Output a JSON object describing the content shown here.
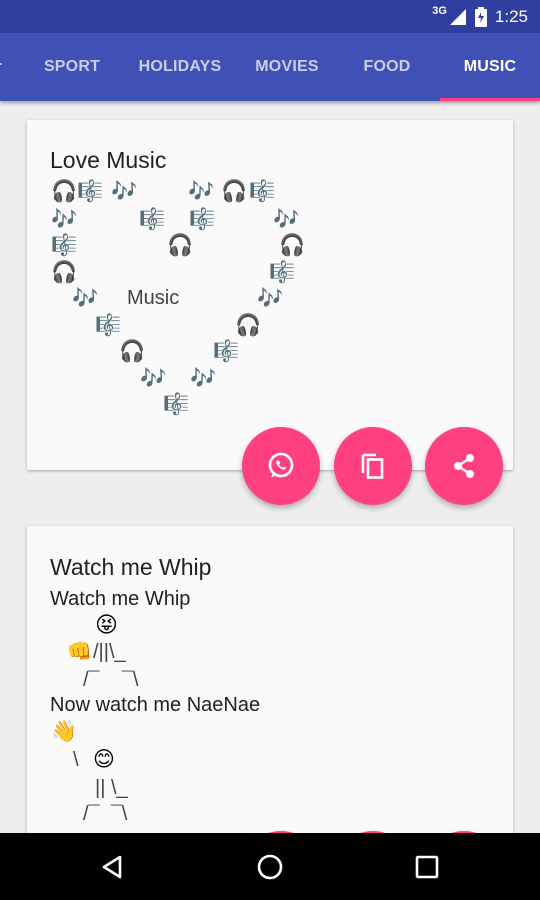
{
  "status_bar": {
    "network": "3G",
    "time": "1:25"
  },
  "tabs": [
    {
      "label": "SPORT",
      "active": false
    },
    {
      "label": "HOLIDAYS",
      "active": false
    },
    {
      "label": "MOVIES",
      "active": false
    },
    {
      "label": "FOOD",
      "active": false
    },
    {
      "label": "MUSIC",
      "active": true
    }
  ],
  "cards": [
    {
      "title": "Love Music",
      "center_text": "Music",
      "emoji": {
        "headphones": "🎧",
        "music_score": "🎼",
        "music_notes": "🎶"
      },
      "actions": [
        "whatsapp-icon",
        "copy-icon",
        "share-icon"
      ]
    },
    {
      "title": "Watch me Whip",
      "lines": [
        "Watch me Whip",
        "Now watch me NaeNae"
      ],
      "emoji": {
        "face": "😝",
        "fist": "👊",
        "hand": "👋",
        "blush_face": "😊"
      },
      "ascii_whip": [
        "/||\\_",
        "/¯    ¯\\"
      ],
      "ascii_naenae": [
        "\\",
        "|| \\_",
        "/¯  ¯\\"
      ]
    }
  ],
  "colors": {
    "primary": "#3f51b5",
    "primary_dark": "#303f9f",
    "accent": "#ff4081"
  }
}
